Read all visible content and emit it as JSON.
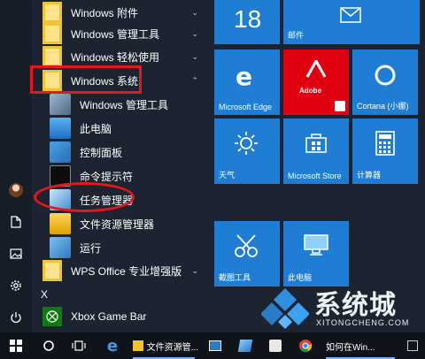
{
  "applist": {
    "items": [
      {
        "label": "Windows 附件",
        "kind": "folder",
        "chevron": "⌄"
      },
      {
        "label": "Windows 管理工具",
        "kind": "folder",
        "chevron": "⌄"
      },
      {
        "label": "Windows 轻松使用",
        "kind": "folder",
        "chevron": "⌄"
      },
      {
        "label": "Windows 系统",
        "kind": "folder",
        "chevron": "⌃"
      },
      {
        "label": "Windows 管理工具",
        "kind": "app"
      },
      {
        "label": "此电脑",
        "kind": "app"
      },
      {
        "label": "控制面板",
        "kind": "app"
      },
      {
        "label": "命令提示符",
        "kind": "app"
      },
      {
        "label": "任务管理器",
        "kind": "app"
      },
      {
        "label": "文件资源管理器",
        "kind": "app"
      },
      {
        "label": "运行",
        "kind": "app"
      },
      {
        "label": "WPS Office 专业增强版",
        "kind": "folder",
        "chevron": "⌄"
      }
    ],
    "section_letter": "X",
    "xbox": {
      "label": "Xbox Game Bar"
    }
  },
  "tiles": {
    "calendar_day": "18",
    "mail": "邮件",
    "edge": "Microsoft Edge",
    "adobe": "Adobe",
    "cortana": "Cortana (小娜)",
    "weather": "天气",
    "store": "Microsoft Store",
    "calculator": "计算器",
    "snip": "截图工具",
    "thispc": "此电脑"
  },
  "taskbar": {
    "explorer_label": "文件资源管...",
    "right_label": "如何在Win..."
  },
  "watermark": {
    "text": "系统城",
    "url": "XITONGCHENG.COM"
  },
  "colors": {
    "tile_blue": "#1f7ed4",
    "adobe_red": "#e00010",
    "annotation_red": "#e5161c",
    "folder_yellow": "#f1c232"
  }
}
